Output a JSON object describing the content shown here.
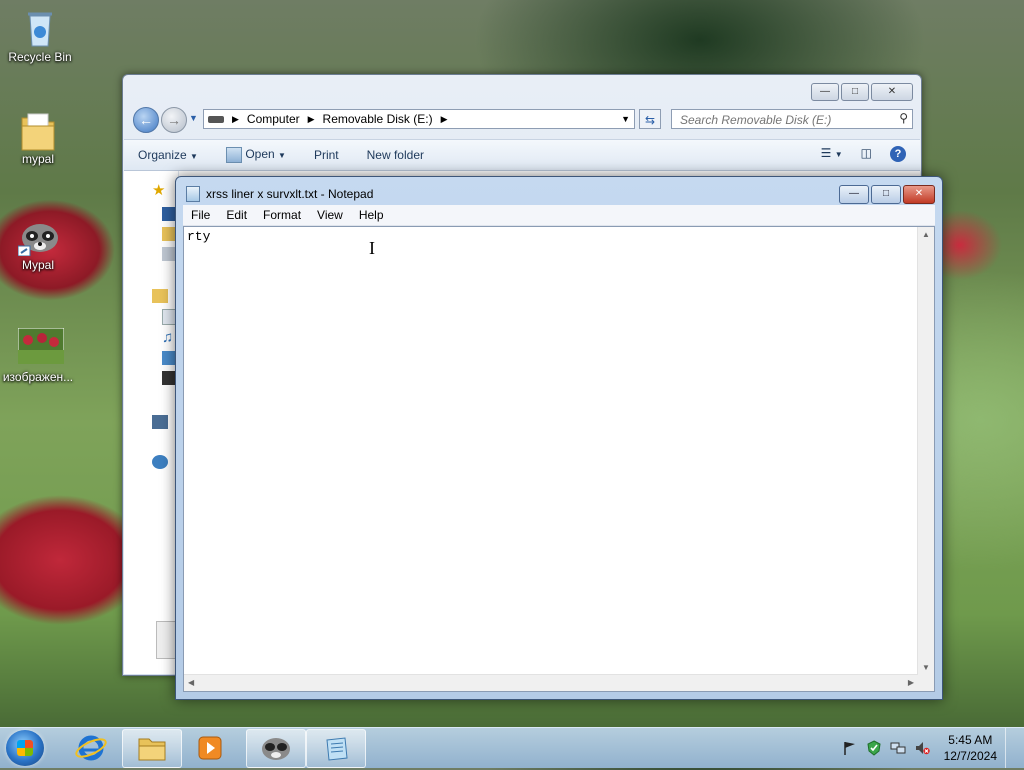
{
  "desktop": {
    "icons": [
      {
        "label": "Recycle Bin"
      },
      {
        "label": "mypal"
      },
      {
        "label": "Mypal"
      },
      {
        "label": "изображен..."
      }
    ]
  },
  "explorer": {
    "address": {
      "segments": [
        "Computer",
        "Removable Disk (E:)"
      ]
    },
    "search": {
      "placeholder": "Search Removable Disk (E:)"
    },
    "toolbar": {
      "organize": "Organize",
      "open": "Open",
      "print": "Print",
      "new_folder": "New folder"
    }
  },
  "notepad": {
    "title": "xrss liner x survxlt.txt - Notepad",
    "menu": [
      "File",
      "Edit",
      "Format",
      "View",
      "Help"
    ],
    "content": "rty"
  },
  "taskbar": {
    "clock": {
      "time": "5:45 AM",
      "date": "12/7/2024"
    }
  },
  "colors": {
    "accent": "#2a73c6",
    "close_red": "#c13a25"
  }
}
